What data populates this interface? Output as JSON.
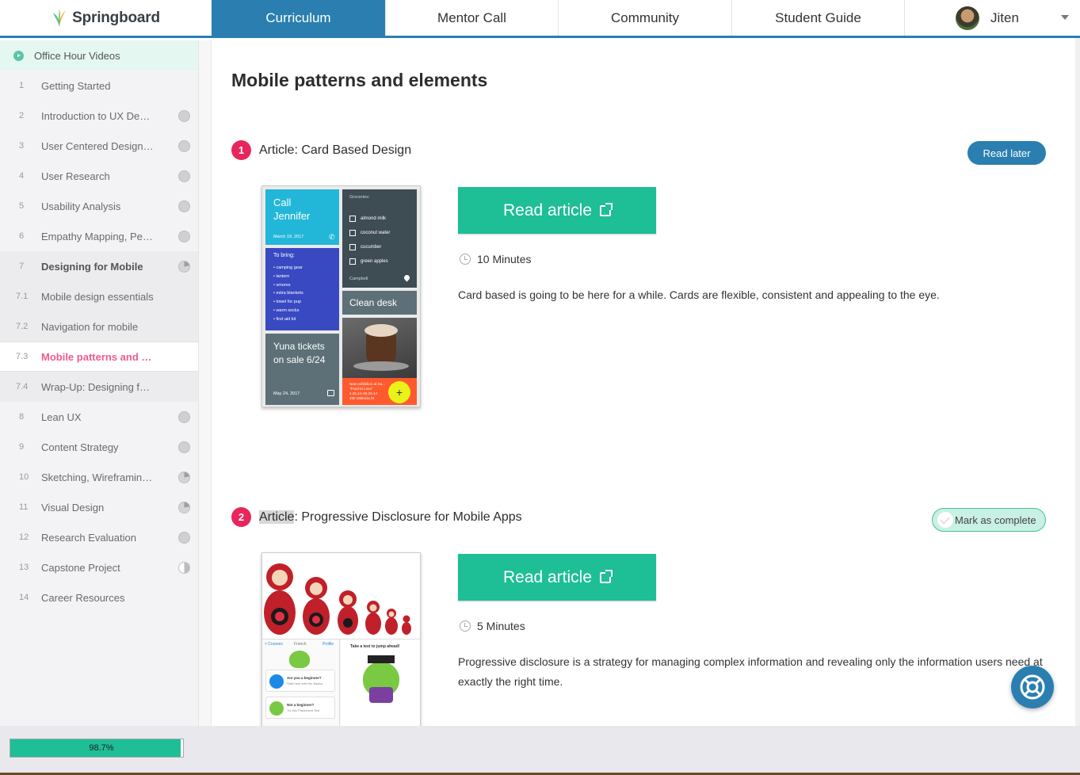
{
  "app": {
    "logo_text": "Springboard"
  },
  "nav": {
    "tabs": [
      {
        "label": "Curriculum",
        "active": true
      },
      {
        "label": "Mentor Call"
      },
      {
        "label": "Community"
      },
      {
        "label": "Student Guide"
      }
    ],
    "user_name": "Jiten"
  },
  "sidebar": {
    "office_hour": "Office Hour Videos",
    "items": [
      {
        "num": "1",
        "label": "Getting Started",
        "status": "none"
      },
      {
        "num": "2",
        "label": "Introduction to UX Desi...",
        "status": "empty"
      },
      {
        "num": "3",
        "label": "User Centered Design ...",
        "status": "empty"
      },
      {
        "num": "4",
        "label": "User Research",
        "status": "empty"
      },
      {
        "num": "5",
        "label": "Usability Analysis",
        "status": "empty"
      },
      {
        "num": "6",
        "label": "Empathy Mapping, Per...",
        "status": "empty"
      },
      {
        "num": "7",
        "label": "Designing for Mobile",
        "status": "partial"
      },
      {
        "num": "7.1",
        "label": "Mobile design essentials",
        "status": "none"
      },
      {
        "num": "7.2",
        "label": "Navigation for mobile",
        "status": "none"
      },
      {
        "num": "7.3",
        "label": "Mobile patterns and e...",
        "status": "none"
      },
      {
        "num": "7.4",
        "label": "Wrap-Up: Designing for...",
        "status": "none"
      },
      {
        "num": "8",
        "label": "Lean UX",
        "status": "empty"
      },
      {
        "num": "9",
        "label": "Content Strategy",
        "status": "empty"
      },
      {
        "num": "10",
        "label": "Sketching, Wireframing...",
        "status": "partial"
      },
      {
        "num": "11",
        "label": "Visual Design",
        "status": "partial"
      },
      {
        "num": "12",
        "label": "Research Evaluation",
        "status": "empty"
      },
      {
        "num": "13",
        "label": "Capstone Project",
        "status": "half"
      },
      {
        "num": "14",
        "label": "Career Resources",
        "status": "none"
      }
    ]
  },
  "main": {
    "title": "Mobile patterns and elements",
    "articles": [
      {
        "number": "1",
        "kind": "Article",
        "title": ": Card Based Design",
        "action_label": "Read later",
        "read_label": "Read article",
        "duration": "10 Minutes",
        "description": "Card based is going to be here for a while. Cards are flexible, consistent and appealing to the eye.",
        "thumb": {
          "call_title": "Call\nJennifer",
          "call_date": "March 19, 2017",
          "groceries": "Groceries:",
          "grocery_items": [
            "almond milk",
            "coconut water",
            "cucumber",
            "green apples"
          ],
          "grocery_place": "Campbell",
          "to_bring_title": "To bring:",
          "to_bring": [
            "• camping gear",
            "• lantern",
            "• smores",
            "• extra blankets",
            "• towel for pup",
            "• warm socks",
            "• first aid kit"
          ],
          "clean_desk": "Clean desk",
          "yuna": "Yuna tickets on sale 6/24",
          "yuna_date": "May 24, 2017",
          "exhibition": "New exhibition at Da...\n\"Food to Love\"\n4.25.14–05.26.14\n230 Valencia St"
        }
      },
      {
        "number": "2",
        "kind": "Article",
        "title": ": Progressive Disclosure for Mobile Apps",
        "action_label": "Mark as complete",
        "read_label": "Read article",
        "duration": "5 Minutes",
        "description": "Progressive disclosure is a strategy for managing complex information and revealing only the information users need at exactly the right time.",
        "thumb": {
          "tabs": [
            "< Courses",
            "French",
            "Profile"
          ],
          "jump": "Take a test to jump ahead!",
          "beginner_q": "Are you a beginner?",
          "beginner_sub": "Start here with the Basics",
          "not_beginner_q": "Not a beginner?",
          "not_beginner_sub": "Try this Placement Test"
        }
      }
    ]
  },
  "footer": {
    "progress_label": "98.7%",
    "progress_fraction": 0.987
  },
  "colors": {
    "brand_blue": "#2a7fb0",
    "accent_green": "#1ebe96",
    "badge_pink": "#e8265c",
    "current_item": "#f05a8c"
  },
  "icons": {
    "help": "lifebuoy-icon",
    "clock": "clock-icon",
    "external": "external-link-icon"
  }
}
